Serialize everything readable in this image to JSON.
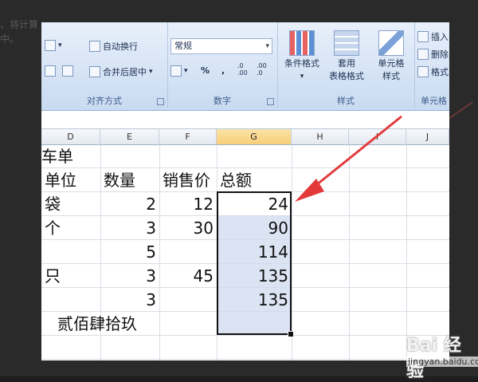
{
  "background": {
    "lines": [
      "、将计算",
      "中。"
    ]
  },
  "ribbon": {
    "alignment": {
      "wrap_text": "自动换行",
      "merge_center": "合并后居中",
      "group_label": "对齐方式"
    },
    "number": {
      "format_value": "常规",
      "percent": "%",
      "comma": ",",
      "inc_decimal": ".0 .00",
      "dec_decimal": ".00 .0",
      "group_label": "数字"
    },
    "styles": {
      "conditional_format": [
        "条件格式",
        ""
      ],
      "table_format": [
        "套用",
        "表格格式"
      ],
      "cell_style": [
        "单元格",
        "样式"
      ],
      "group_label": "样式"
    },
    "cells": {
      "insert": "插入",
      "delete": "删除",
      "format": "格式",
      "group_label": "单元格"
    }
  },
  "columns": [
    "D",
    "E",
    "F",
    "G",
    "H",
    "I",
    "J"
  ],
  "selected_column": "G",
  "sheet": {
    "title_fragment": "车单",
    "headers": [
      "单位",
      "数量",
      "销售价",
      "总额"
    ],
    "rows": [
      {
        "unit": "袋",
        "qty": "2",
        "price": "12",
        "total": "24"
      },
      {
        "unit": "个",
        "qty": "3",
        "price": "30",
        "total": "90"
      },
      {
        "unit": "",
        "qty": "5",
        "price": "",
        "total": "114"
      },
      {
        "unit": "只",
        "qty": "3",
        "price": "45",
        "total": "135"
      },
      {
        "unit": "",
        "qty": "3",
        "price": "",
        "total": "135"
      }
    ],
    "chinese_amount": "贰佰肆拾玖"
  },
  "watermark": {
    "logo": "Bai 经验",
    "url": "jingyan.baidu.com"
  },
  "colors": {
    "arrow": "#e23a3a",
    "selection_fill": "#d0daee",
    "ribbon": "#d5e3f5"
  }
}
